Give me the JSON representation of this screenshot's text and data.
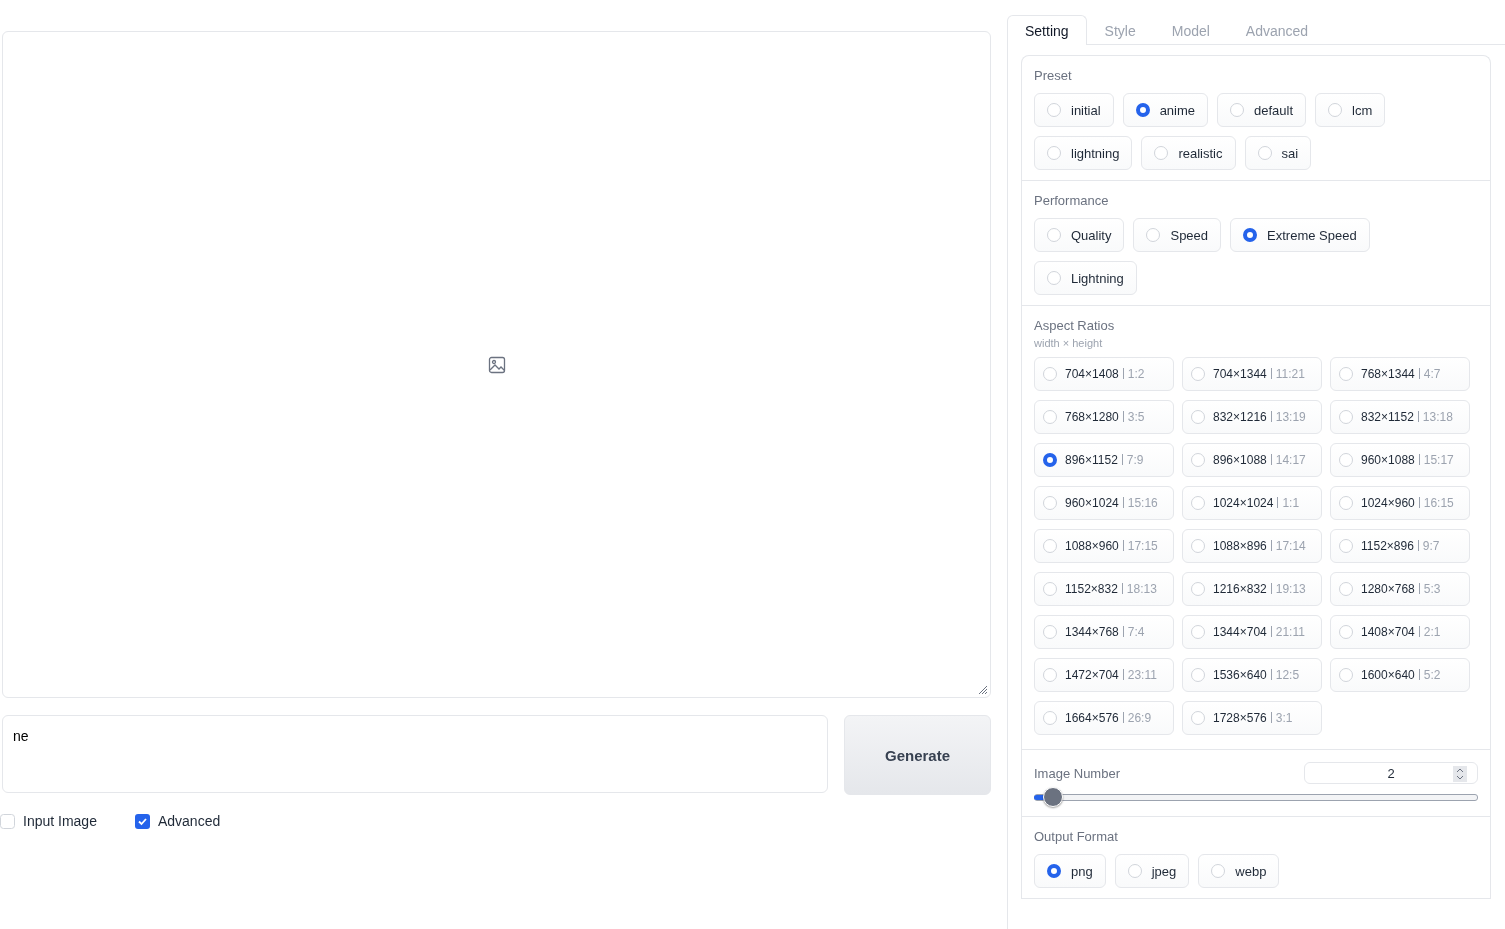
{
  "prompt": {
    "value": "ne"
  },
  "generate_button": "Generate",
  "options": [
    {
      "label": "Input Image",
      "checked": false
    },
    {
      "label": "Advanced",
      "checked": true
    }
  ],
  "tabs": [
    {
      "label": "Setting",
      "selected": true
    },
    {
      "label": "Style",
      "selected": false
    },
    {
      "label": "Model",
      "selected": false
    },
    {
      "label": "Advanced",
      "selected": false
    }
  ],
  "preset": {
    "label": "Preset",
    "options": [
      {
        "label": "initial",
        "selected": false
      },
      {
        "label": "anime",
        "selected": true
      },
      {
        "label": "default",
        "selected": false
      },
      {
        "label": "lcm",
        "selected": false
      },
      {
        "label": "lightning",
        "selected": false
      },
      {
        "label": "realistic",
        "selected": false
      },
      {
        "label": "sai",
        "selected": false
      }
    ]
  },
  "performance": {
    "label": "Performance",
    "options": [
      {
        "label": "Quality",
        "selected": false
      },
      {
        "label": "Speed",
        "selected": false
      },
      {
        "label": "Extreme Speed",
        "selected": true
      },
      {
        "label": "Lightning",
        "selected": false
      }
    ]
  },
  "aspect_ratios": {
    "label": "Aspect Ratios",
    "hint": "width × height",
    "options": [
      {
        "size": "704×1408",
        "ratio": "1:2",
        "selected": false
      },
      {
        "size": "704×1344",
        "ratio": "11:21",
        "selected": false
      },
      {
        "size": "768×1344",
        "ratio": "4:7",
        "selected": false
      },
      {
        "size": "768×1280",
        "ratio": "3:5",
        "selected": false
      },
      {
        "size": "832×1216",
        "ratio": "13:19",
        "selected": false
      },
      {
        "size": "832×1152",
        "ratio": "13:18",
        "selected": false
      },
      {
        "size": "896×1152",
        "ratio": "7:9",
        "selected": true
      },
      {
        "size": "896×1088",
        "ratio": "14:17",
        "selected": false
      },
      {
        "size": "960×1088",
        "ratio": "15:17",
        "selected": false
      },
      {
        "size": "960×1024",
        "ratio": "15:16",
        "selected": false
      },
      {
        "size": "1024×1024",
        "ratio": "1:1",
        "selected": false
      },
      {
        "size": "1024×960",
        "ratio": "16:15",
        "selected": false
      },
      {
        "size": "1088×960",
        "ratio": "17:15",
        "selected": false
      },
      {
        "size": "1088×896",
        "ratio": "17:14",
        "selected": false
      },
      {
        "size": "1152×896",
        "ratio": "9:7",
        "selected": false
      },
      {
        "size": "1152×832",
        "ratio": "18:13",
        "selected": false
      },
      {
        "size": "1216×832",
        "ratio": "19:13",
        "selected": false
      },
      {
        "size": "1280×768",
        "ratio": "5:3",
        "selected": false
      },
      {
        "size": "1344×768",
        "ratio": "7:4",
        "selected": false
      },
      {
        "size": "1344×704",
        "ratio": "21:11",
        "selected": false
      },
      {
        "size": "1408×704",
        "ratio": "2:1",
        "selected": false
      },
      {
        "size": "1472×704",
        "ratio": "23:11",
        "selected": false
      },
      {
        "size": "1536×640",
        "ratio": "12:5",
        "selected": false
      },
      {
        "size": "1600×640",
        "ratio": "5:2",
        "selected": false
      },
      {
        "size": "1664×576",
        "ratio": "26:9",
        "selected": false
      },
      {
        "size": "1728×576",
        "ratio": "3:1",
        "selected": false
      }
    ]
  },
  "image_number": {
    "label": "Image Number",
    "value": "2",
    "level": 0.03
  },
  "output_format": {
    "label": "Output Format",
    "options": [
      {
        "label": "png",
        "selected": true
      },
      {
        "label": "jpeg",
        "selected": false
      },
      {
        "label": "webp",
        "selected": false
      }
    ]
  }
}
